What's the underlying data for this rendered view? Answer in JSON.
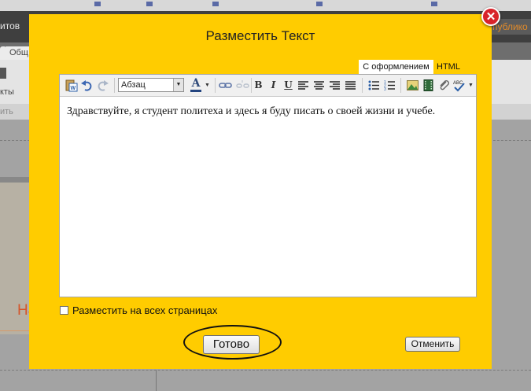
{
  "background": {
    "header_text": "итов",
    "publish_label": "публико",
    "tab_label": "Общ",
    "tools_label": "кты",
    "subbar_text": "ить",
    "left_heading": "На"
  },
  "dialog": {
    "title": "Разместить Текст",
    "close_label": "✕",
    "mode_tabs": [
      {
        "label": "С оформлением",
        "active": true
      },
      {
        "label": "HTML",
        "active": false
      }
    ],
    "toolbar": {
      "paste_word_icon": "paste-from-word-icon",
      "format_value": "Абзац",
      "bold_label": "B",
      "italic_label": "I",
      "underline_label": "U",
      "font_color_label": "A"
    },
    "editor_text": "Здравствуйте, я студент политеха и здесь я буду писать о своей жизни и учебе.",
    "checkbox_label": "Разместить на всех страницах",
    "checkbox_checked": false,
    "done_label": "Готово",
    "cancel_label": "Отменить"
  }
}
